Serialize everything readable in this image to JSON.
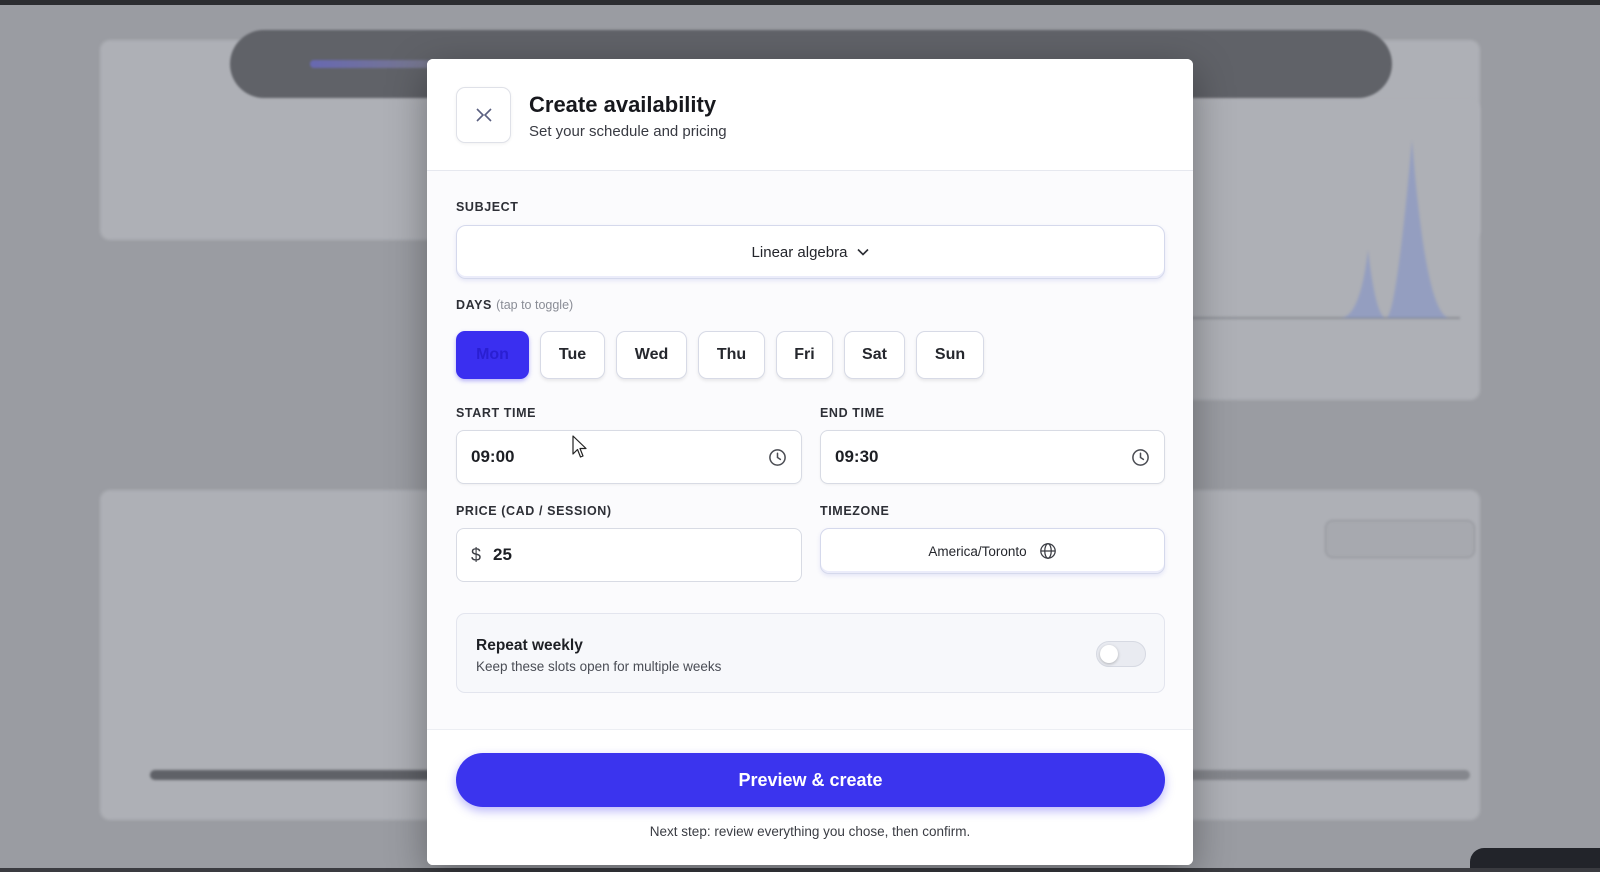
{
  "modal": {
    "title": "Create availability",
    "subtitle": "Set your schedule and pricing"
  },
  "subject": {
    "label": "SUBJECT",
    "value": "Linear algebra",
    "icon": "chevron-down-icon"
  },
  "days": {
    "label": "DAYS",
    "hint": "(tap to toggle)",
    "items": [
      {
        "label": "Mon",
        "active": true
      },
      {
        "label": "Tue",
        "active": false
      },
      {
        "label": "Wed",
        "active": false
      },
      {
        "label": "Thu",
        "active": false
      },
      {
        "label": "Fri",
        "active": false
      },
      {
        "label": "Sat",
        "active": false
      },
      {
        "label": "Sun",
        "active": false
      }
    ]
  },
  "start_time": {
    "label": "START TIME",
    "value": "09:00",
    "icon": "clock-icon"
  },
  "end_time": {
    "label": "END TIME",
    "value": "09:30",
    "icon": "clock-icon"
  },
  "price": {
    "label": "PRICE (CAD / SESSION)",
    "currency": "$",
    "value": "25"
  },
  "timezone": {
    "label": "TIMEZONE",
    "value": "America/Toronto",
    "icon": "globe-icon"
  },
  "repeat": {
    "title": "Repeat weekly",
    "subtitle": "Keep these slots open for multiple weeks",
    "enabled": false
  },
  "footer": {
    "primary_label": "Preview & create",
    "note": "Next step: review everything you chose, then confirm."
  },
  "colors": {
    "accent": "#3b34ee",
    "overlay": "#6f7178"
  }
}
